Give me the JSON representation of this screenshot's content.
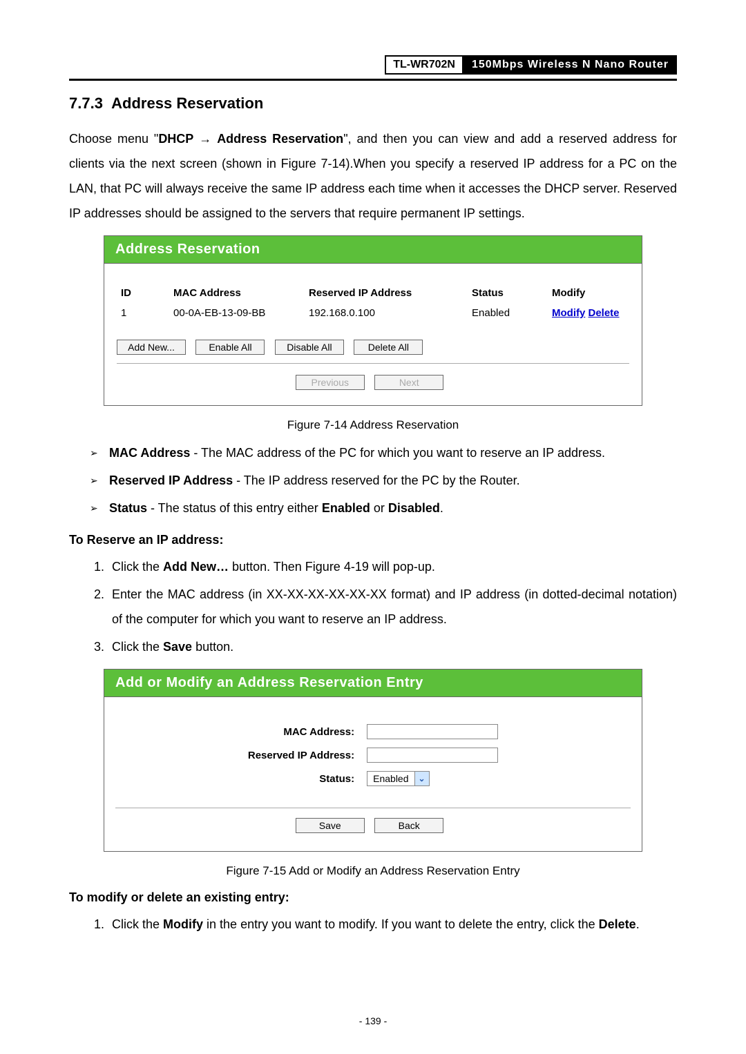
{
  "header": {
    "model": "TL-WR702N",
    "desc": "150Mbps Wireless N Nano Router"
  },
  "section": {
    "number": "7.7.3",
    "title": "Address Reservation"
  },
  "intro": {
    "pre": "Choose menu \"",
    "menu1": "DHCP",
    "arrow": " → ",
    "menu2": "Address Reservation",
    "post": "\", and then you can view and add a reserved address for clients via the next screen (shown in Figure 7-14).When you specify a reserved IP address for a PC on the LAN, that PC will always receive the same IP address each time when it accesses the DHCP server. Reserved IP addresses should be assigned to the servers that require permanent IP settings."
  },
  "fig14": {
    "title": "Address Reservation",
    "columns": {
      "id": "ID",
      "mac": "MAC Address",
      "ip": "Reserved IP Address",
      "status": "Status",
      "modify": "Modify"
    },
    "rows": [
      {
        "id": "1",
        "mac": "00-0A-EB-13-09-BB",
        "ip": "192.168.0.100",
        "status": "Enabled",
        "modify": "Modify",
        "delete": "Delete"
      }
    ],
    "buttons": {
      "add": "Add New...",
      "enable": "Enable All",
      "disable": "Disable All",
      "delete": "Delete All",
      "prev": "Previous",
      "next": "Next"
    },
    "caption": "Figure 7-14   Address Reservation"
  },
  "defs": {
    "mac": {
      "term": "MAC Address",
      "text": " - The MAC address of the PC for which you want to reserve an IP address."
    },
    "ip": {
      "term": "Reserved IP Address",
      "text": " - The IP address reserved for the PC by the Router."
    },
    "stat": {
      "term": "Status",
      "text_a": " - The status of this entry either ",
      "en": "Enabled",
      "mid": " or ",
      "dis": "Disabled",
      "end": "."
    }
  },
  "reserve_head": "To Reserve an IP address:",
  "reserve_steps": {
    "s1a": "Click the ",
    "s1b": "Add New…",
    "s1c": " button. Then Figure 4-19 will pop-up.",
    "s2": "Enter the MAC address (in XX-XX-XX-XX-XX-XX format) and IP address (in dotted-decimal notation) of the computer for which you want to reserve an IP address.",
    "s3a": "Click the ",
    "s3b": "Save",
    "s3c": " button."
  },
  "fig15": {
    "title": "Add or Modify an Address Reservation Entry",
    "labels": {
      "mac": "MAC Address:",
      "ip": "Reserved IP Address:",
      "status": "Status:"
    },
    "status_value": "Enabled",
    "buttons": {
      "save": "Save",
      "back": "Back"
    },
    "caption": "Figure 7-15   Add or Modify an Address Reservation Entry"
  },
  "modify_head": "To modify or delete an existing entry:",
  "modify_steps": {
    "s1a": "Click the ",
    "s1b": "Modify",
    "s1c": " in the entry you want to modify. If you want to delete the entry, click the ",
    "s1d": "Delete",
    "s1e": "."
  },
  "page_number": "- 139 -"
}
